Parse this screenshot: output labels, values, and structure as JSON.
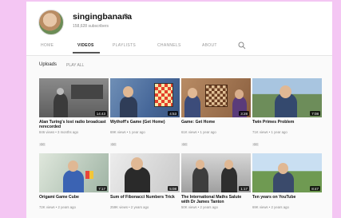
{
  "channel": {
    "name": "singingbanana",
    "verified_icon": "verified-icon",
    "subscribers": "158,628 subscribers"
  },
  "tabs": [
    {
      "label": "HOME"
    },
    {
      "label": "VIDEOS"
    },
    {
      "label": "PLAYLISTS"
    },
    {
      "label": "CHANNELS"
    },
    {
      "label": "ABOUT"
    }
  ],
  "section": {
    "title": "Uploads",
    "play_all": "PLAY ALL"
  },
  "videos": [
    {
      "title": "Alan Turing's lost radio broadcast rerecorded",
      "views": "846 views • 3 months ago",
      "badge": "CC",
      "duration": "14:43"
    },
    {
      "title": "Wythoff's Game (Get Home)",
      "views": "69K views • 1 year ago",
      "badge": "CC",
      "duration": "4:53"
    },
    {
      "title": "Game: Get Home",
      "views": "61K views • 1 year ago",
      "badge": "CC",
      "duration": "3:28"
    },
    {
      "title": "Twin Primes Problem",
      "views": "71K views • 1 year ago",
      "badge": "CC",
      "duration": "7:08"
    },
    {
      "title": "Origami Game Cube",
      "views": "72K views • 2 years ago",
      "badge": "CC",
      "duration": "7:17"
    },
    {
      "title": "Sum of Fibonacci Numbers Trick",
      "views": "259K views • 2 years ago",
      "badge": "CC",
      "duration": "5:08"
    },
    {
      "title": "The International Maths Salute with Dr James Tanton",
      "views": "50K views • 2 years ago",
      "badge": "CC",
      "duration": "1:17"
    },
    {
      "title": "Ten years on YouTube",
      "views": "69K views • 2 years ago",
      "badge": "CC",
      "duration": "8:47"
    }
  ]
}
